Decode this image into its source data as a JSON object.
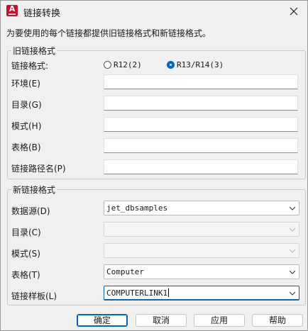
{
  "window": {
    "title": "链接转换",
    "app_icon_letter": "A"
  },
  "intro_text": "为要使用的每个链接都提供旧链接格式和新链接格式。",
  "old_group": {
    "title": "旧链接格式",
    "format_label": "链接格式:",
    "radio_r12": "R12(2)",
    "radio_r13": "R13/R14(3)",
    "selected": "R13/R14(3)",
    "env_label": "环境(E)",
    "catalog_label": "目录(G)",
    "schema_label": "模式(H)",
    "table_label": "表格(B)",
    "path_label": "链接路径名(P)",
    "env_value": "",
    "catalog_value": "",
    "schema_value": "",
    "table_value": "",
    "path_value": ""
  },
  "new_group": {
    "title": "新链接格式",
    "datasource_label": "数据源(D)",
    "datasource_value": "jet_dbsamples",
    "catalog_label": "目录(C)",
    "catalog_value": "",
    "schema_label": "模式(S)",
    "schema_value": "",
    "table_label": "表格(T)",
    "table_value": "Computer",
    "template_label": "链接样板(L)",
    "template_value": "COMPUTERLINK1"
  },
  "buttons": {
    "ok": "确定",
    "cancel": "取消",
    "apply": "应用",
    "help": "帮助"
  }
}
